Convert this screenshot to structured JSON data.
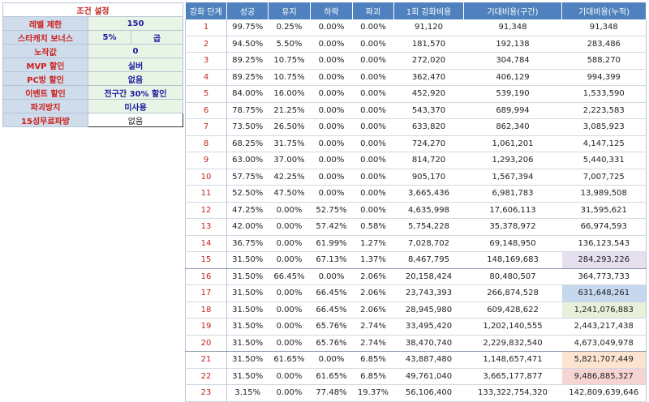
{
  "conditions": {
    "title": "조건 설정",
    "rows": [
      {
        "label": "레벨 제한",
        "value": "150"
      },
      {
        "label": "스타캐치 보너스",
        "value": "5%",
        "value2": "곱"
      },
      {
        "label": "노작값",
        "value": "0"
      },
      {
        "label": "MVP 할인",
        "value": "실버"
      },
      {
        "label": "PC방 할인",
        "value": "없음"
      },
      {
        "label": "이벤트 할인",
        "value": "전구간 30% 할인"
      },
      {
        "label": "파괴방지",
        "value": "미사용"
      },
      {
        "label": "15성무료파방",
        "value": "없음"
      }
    ],
    "dropdown_icon": "chevron-down-icon"
  },
  "table": {
    "headers": [
      "강화 단계",
      "성공",
      "유지",
      "하락",
      "파괴",
      "1회 강화비용",
      "기대비용(구간)",
      "기대비용(누적)"
    ],
    "rows": [
      [
        "1",
        "99.75%",
        "0.25%",
        "0.00%",
        "0.00%",
        "91,120",
        "91,348",
        "91,348"
      ],
      [
        "2",
        "94.50%",
        "5.50%",
        "0.00%",
        "0.00%",
        "181,570",
        "192,138",
        "283,486"
      ],
      [
        "3",
        "89.25%",
        "10.75%",
        "0.00%",
        "0.00%",
        "272,020",
        "304,784",
        "588,270"
      ],
      [
        "4",
        "89.25%",
        "10.75%",
        "0.00%",
        "0.00%",
        "362,470",
        "406,129",
        "994,399"
      ],
      [
        "5",
        "84.00%",
        "16.00%",
        "0.00%",
        "0.00%",
        "452,920",
        "539,190",
        "1,533,590"
      ],
      [
        "6",
        "78.75%",
        "21.25%",
        "0.00%",
        "0.00%",
        "543,370",
        "689,994",
        "2,223,583"
      ],
      [
        "7",
        "73.50%",
        "26.50%",
        "0.00%",
        "0.00%",
        "633,820",
        "862,340",
        "3,085,923"
      ],
      [
        "8",
        "68.25%",
        "31.75%",
        "0.00%",
        "0.00%",
        "724,270",
        "1,061,201",
        "4,147,125"
      ],
      [
        "9",
        "63.00%",
        "37.00%",
        "0.00%",
        "0.00%",
        "814,720",
        "1,293,206",
        "5,440,331"
      ],
      [
        "10",
        "57.75%",
        "42.25%",
        "0.00%",
        "0.00%",
        "905,170",
        "1,567,394",
        "7,007,725"
      ],
      [
        "11",
        "52.50%",
        "47.50%",
        "0.00%",
        "0.00%",
        "3,665,436",
        "6,981,783",
        "13,989,508"
      ],
      [
        "12",
        "47.25%",
        "0.00%",
        "52.75%",
        "0.00%",
        "4,635,998",
        "17,606,113",
        "31,595,621"
      ],
      [
        "13",
        "42.00%",
        "0.00%",
        "57.42%",
        "0.58%",
        "5,754,228",
        "35,378,972",
        "66,974,593"
      ],
      [
        "14",
        "36.75%",
        "0.00%",
        "61.99%",
        "1.27%",
        "7,028,702",
        "69,148,950",
        "136,123,543"
      ],
      [
        "15",
        "31.50%",
        "0.00%",
        "67.13%",
        "1.37%",
        "8,467,795",
        "148,169,683",
        "284,293,226"
      ],
      [
        "16",
        "31.50%",
        "66.45%",
        "0.00%",
        "2.06%",
        "20,158,424",
        "80,480,507",
        "364,773,733"
      ],
      [
        "17",
        "31.50%",
        "0.00%",
        "66.45%",
        "2.06%",
        "23,743,393",
        "266,874,528",
        "631,648,261"
      ],
      [
        "18",
        "31.50%",
        "0.00%",
        "66.45%",
        "2.06%",
        "28,945,980",
        "609,428,622",
        "1,241,076,883"
      ],
      [
        "19",
        "31.50%",
        "0.00%",
        "65.76%",
        "2.74%",
        "33,495,420",
        "1,202,140,555",
        "2,443,217,438"
      ],
      [
        "20",
        "31.50%",
        "0.00%",
        "65.76%",
        "2.74%",
        "38,470,740",
        "2,229,832,540",
        "4,673,049,978"
      ],
      [
        "21",
        "31.50%",
        "61.65%",
        "0.00%",
        "6.85%",
        "43,887,480",
        "1,148,657,471",
        "5,821,707,449"
      ],
      [
        "22",
        "31.50%",
        "0.00%",
        "61.65%",
        "6.85%",
        "49,761,040",
        "3,665,177,877",
        "9,486,885,327"
      ],
      [
        "23",
        "3.15%",
        "0.00%",
        "77.48%",
        "19.37%",
        "56,106,400",
        "133,322,754,320",
        "142,809,639,646"
      ]
    ],
    "highlights": {
      "15": "#e6dff0",
      "17": "#c5d8ee",
      "18": "#e6f0da",
      "21": "#fde4d0",
      "22": "#f6d4d4"
    }
  }
}
